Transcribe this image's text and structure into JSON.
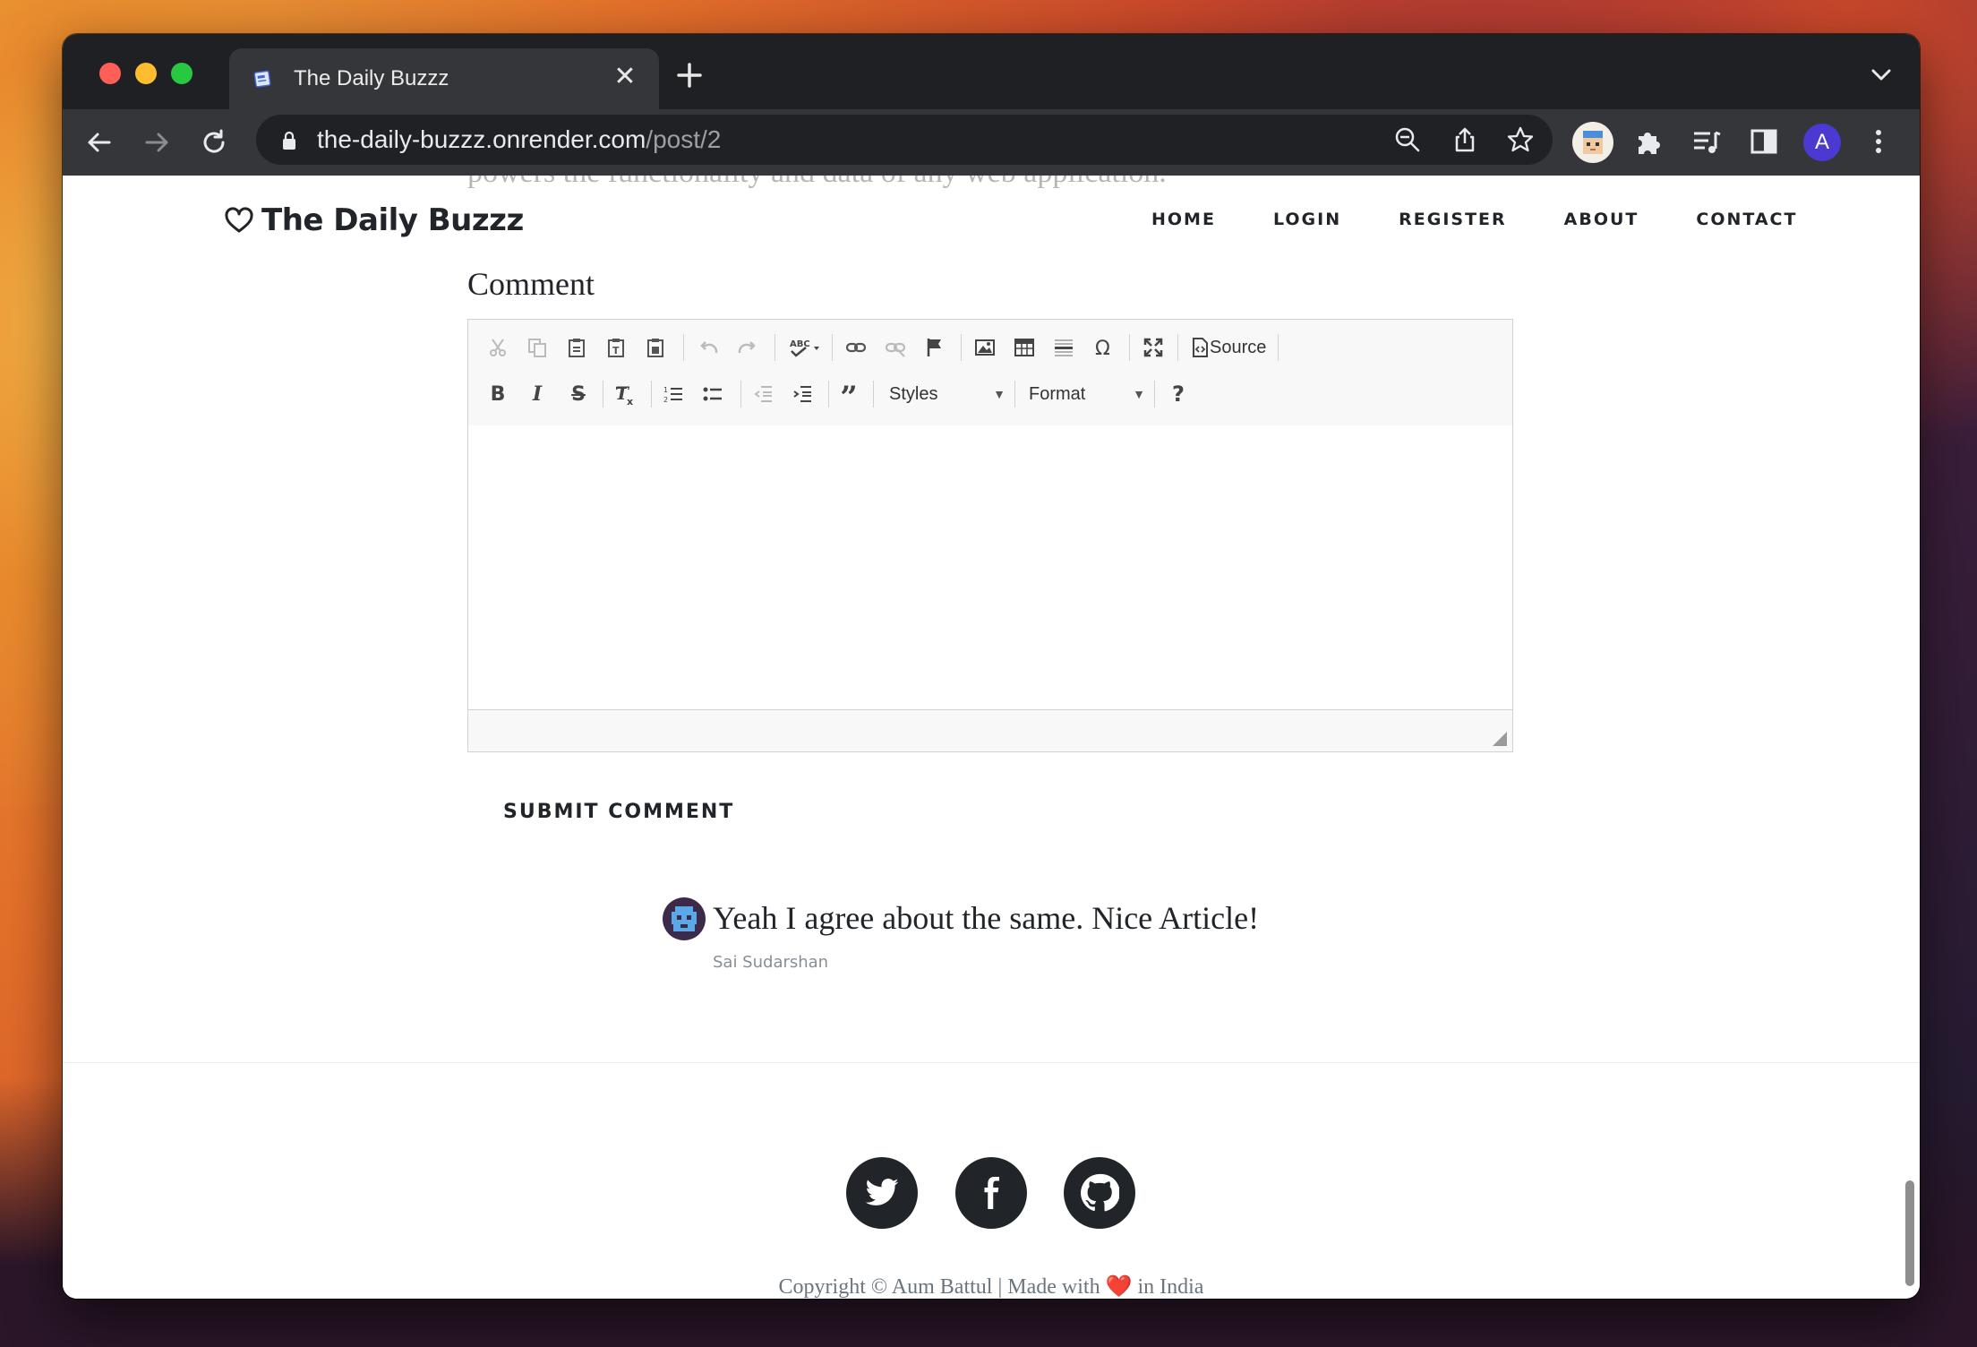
{
  "browser": {
    "tab_title": "The Daily Buzzz",
    "tab_close": "✕",
    "url_host": "the-daily-buzzz.onrender.com",
    "url_path": "/post/2",
    "profile_initial": "A"
  },
  "page": {
    "ghost_text": "powers the functionality and data of any web application.",
    "brand": "The Daily Buzzz",
    "nav": [
      "HOME",
      "LOGIN",
      "REGISTER",
      "ABOUT",
      "CONTACT"
    ],
    "comment_label": "Comment",
    "editor": {
      "source_label": "Source",
      "styles_label": "Styles",
      "format_label": "Format"
    },
    "submit_label": "SUBMIT COMMENT",
    "comments": [
      {
        "text": "Yeah I agree about the same. Nice Article!",
        "author": "Sai Sudarshan"
      }
    ],
    "social": [
      "twitter-icon",
      "facebook-icon",
      "github-icon"
    ],
    "copyright_prefix": "Copyright © Aum Battul | Made with",
    "copyright_heart": "❤️",
    "copyright_suffix": "in India"
  }
}
